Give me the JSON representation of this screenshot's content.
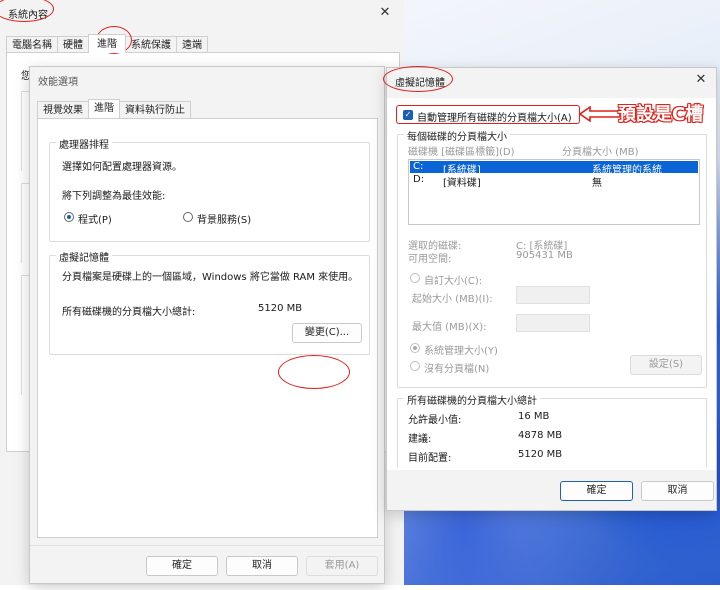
{
  "sys_props": {
    "title": "系統內容",
    "tabs": [
      "電腦名稱",
      "硬體",
      "進階",
      "系統保護",
      "遠端"
    ],
    "side_label": "您"
  },
  "perf": {
    "title": "效能選項",
    "tabs": [
      "視覺效果",
      "進階",
      "資料執行防止"
    ],
    "cpu_group": "處理器排程",
    "cpu_desc": "選擇如何配置處理器資源。",
    "cpu_adjust": "將下列調整為最佳效能:",
    "radio_programs": "程式(P)",
    "radio_services": "背景服務(S)",
    "vm_group": "虛擬記憶體",
    "vm_desc": "分頁檔案是硬碟上的一個區域，Windows 將它當做 RAM 來使用。",
    "vm_total_label": "所有磁碟機的分頁檔大小總計:",
    "vm_total_value": "5120 MB",
    "change_button": "變更(C)...",
    "ok": "確定",
    "cancel": "取消",
    "apply": "套用(A)"
  },
  "vm": {
    "title": "虛擬記憶體",
    "auto_manage": "自動管理所有磁碟的分頁檔大小(A)",
    "annotation": "預設是C槽",
    "per_drive_group": "每個磁碟的分頁檔大小",
    "col_drive": "磁碟機 [磁碟區標籤](D)",
    "col_size": "分頁檔大小 (MB)",
    "drives": [
      {
        "drive": "C:",
        "label": "[系統碟]",
        "size": "系統管理的系統"
      },
      {
        "drive": "D:",
        "label": "[資料碟]",
        "size": "無"
      }
    ],
    "selected_label": "選取的磁碟:",
    "selected_value": "C: [系統碟]",
    "free_label": "可用空間:",
    "free_value": "905431 MB",
    "custom_size": "自訂大小(C):",
    "initial_size": "起始大小 (MB)(I):",
    "max_size": "最大值 (MB)(X):",
    "system_managed": "系統管理大小(Y)",
    "no_paging": "沒有分頁檔(N)",
    "set_button": "設定(S)",
    "total_group": "所有磁碟機的分頁檔大小總計",
    "min_label": "允許最小值:",
    "min_value": "16 MB",
    "rec_label": "建議:",
    "rec_value": "4878 MB",
    "cur_label": "目前配置:",
    "cur_value": "5120 MB",
    "ok": "確定",
    "cancel": "取消"
  },
  "colors": {
    "accent": "#1a5fb4",
    "annotation_red": "#e0201a",
    "selection": "#0a64d6"
  }
}
